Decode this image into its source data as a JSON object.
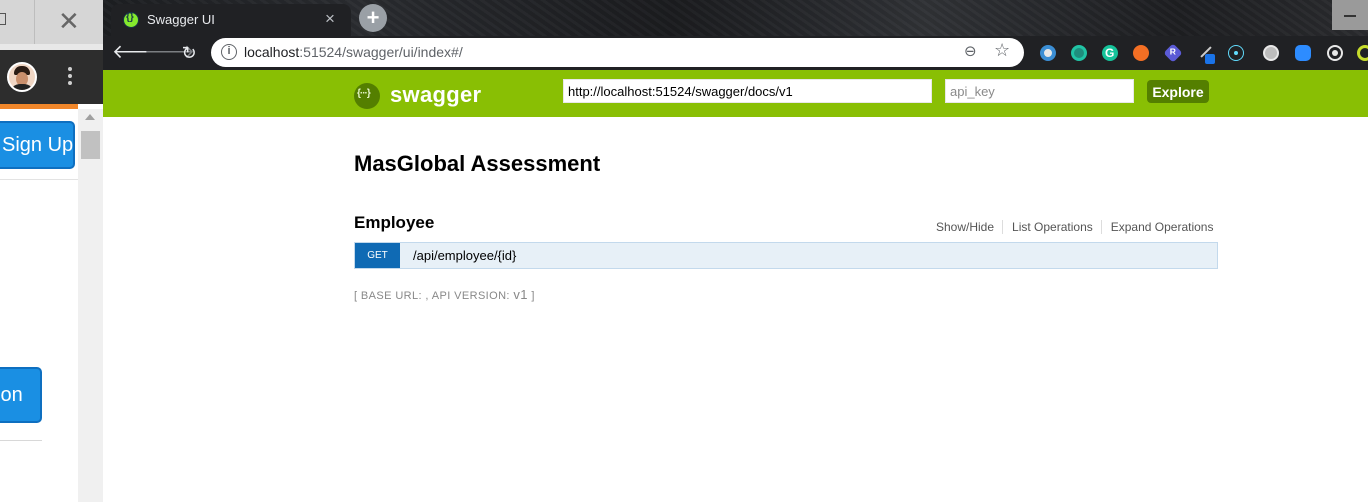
{
  "browser": {
    "tab": {
      "title": "Swagger UI",
      "close_glyph": "×"
    },
    "new_tab_glyph": "+",
    "url": {
      "host": "localhost",
      "rest": ":51524/swagger/ui/index#/"
    },
    "extensions": [
      "extension-icon",
      "grammarly-go-icon",
      "grammarly-icon",
      "metamask-icon",
      "redux-icon",
      "pen-tool-icon",
      "react-devtools-icon",
      "circle-icon",
      "zoom-icon",
      "camera-icon",
      "lime-circle-icon"
    ]
  },
  "left_window": {
    "signup_label": "Sign Up",
    "second_button_label": "ion"
  },
  "swagger": {
    "brand": "swagger",
    "spec_url": "http://localhost:51524/swagger/docs/v1",
    "api_key_placeholder": "api_key",
    "explore_label": "Explore",
    "title": "MasGlobal Assessment",
    "resource": {
      "name": "Employee",
      "options": [
        "Show/Hide",
        "List Operations",
        "Expand Operations"
      ]
    },
    "operation": {
      "method": "GET",
      "path": "/api/employee/{id}"
    },
    "footer": {
      "open": "[ BASE URL: , API VERSION: ",
      "version": "v1",
      "close": " ]"
    }
  },
  "colors": {
    "swagger_green": "#89bf04",
    "explore_button": "#547f00",
    "get_blue": "#0f6ab4",
    "operation_bg": "#e7f0f7"
  }
}
